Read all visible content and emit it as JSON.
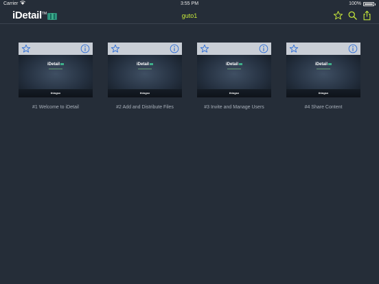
{
  "status_bar": {
    "carrier": "Carrier",
    "time": "3:55 PM",
    "battery": "100%"
  },
  "navbar": {
    "logo_text": "iDetail",
    "logo_tm": "TM",
    "title": "guto1",
    "accent_color": "#c6e83a",
    "icons": [
      "star-icon",
      "search-icon",
      "share-icon"
    ]
  },
  "cards": [
    {
      "label": "#1 Welcome to iDetail",
      "thumb_logo": "iDetail",
      "thumb_footer": "thingsx"
    },
    {
      "label": "#2 Add and Distribute Files",
      "thumb_logo": "iDetail",
      "thumb_footer": "thingsx"
    },
    {
      "label": "#3 Invite and Manage Users",
      "thumb_logo": "iDetail",
      "thumb_footer": "thingsx"
    },
    {
      "label": "#4 Share Content",
      "thumb_logo": "iDetail",
      "thumb_footer": "thingsx"
    }
  ],
  "card_icon_color": "#2f6fd6"
}
